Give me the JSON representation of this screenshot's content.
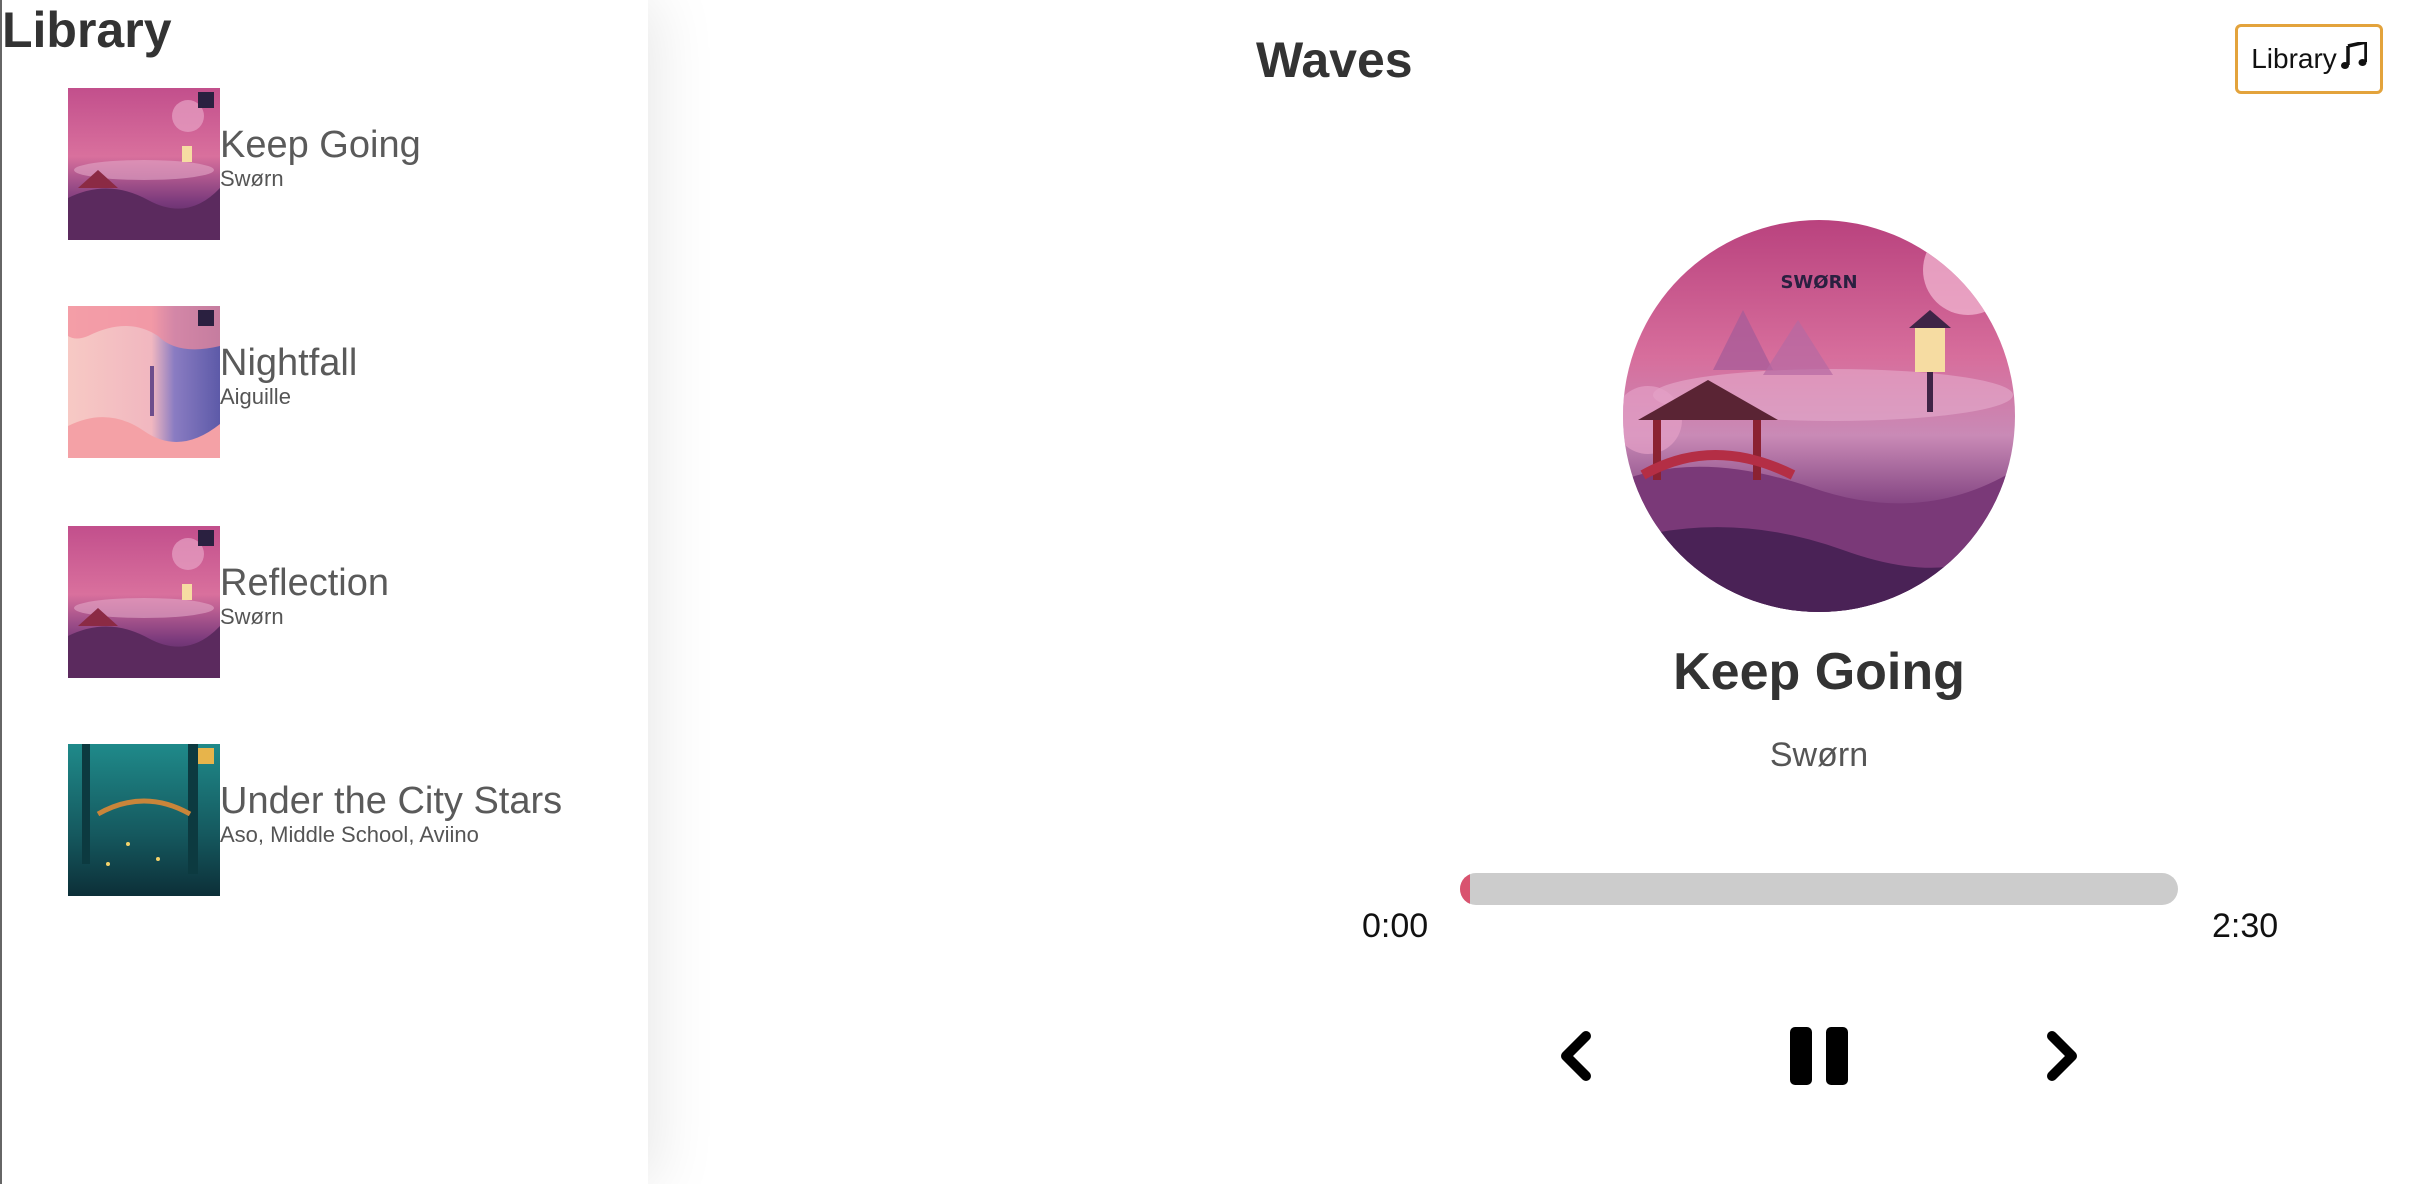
{
  "sidebar": {
    "title": "Library",
    "songs": [
      {
        "name": "Keep Going",
        "artist": "Swørn"
      },
      {
        "name": "Nightfall",
        "artist": "Aiguille"
      },
      {
        "name": "Reflection",
        "artist": "Swørn"
      },
      {
        "name": "Under the City Stars",
        "artist": "Aso, Middle School, Aviino"
      }
    ]
  },
  "header": {
    "title": "Waves",
    "library_button_label": "Library",
    "library_button_icon": "music-note-icon"
  },
  "player": {
    "title": "Keep Going",
    "artist": "Swørn",
    "current_time": "0:00",
    "duration": "2:30",
    "progress": 0.0,
    "accent_color": "#d9536f",
    "controls": {
      "prev_icon": "chevron-left-icon",
      "play_pause_icon": "pause-icon",
      "next_icon": "chevron-right-icon"
    }
  },
  "colors": {
    "library_button_border": "#e3a33c",
    "progress_track": "#cccccc",
    "accent": "#d9536f"
  }
}
